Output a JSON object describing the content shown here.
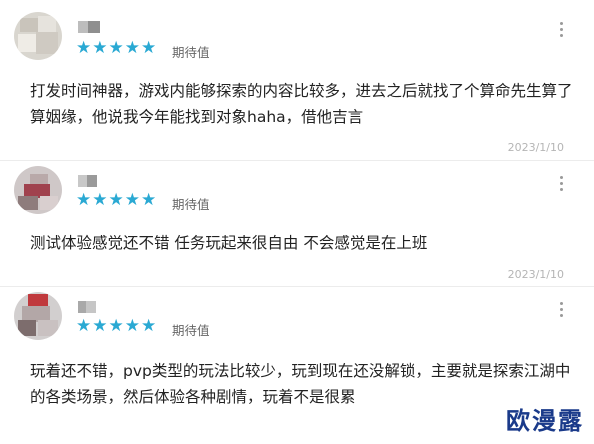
{
  "colors": {
    "star": "#2aa9d3",
    "watermark": "#1a3a8a"
  },
  "reviews": [
    {
      "rating": 5,
      "rating_label": "期待值",
      "text": "打发时间神器，游戏内能够探索的内容比较多，进去之后就找了个算命先生算了算姻缘，他说我今年能找到对象haha，借他吉言",
      "date": "2023/1/10"
    },
    {
      "rating": 5,
      "rating_label": "期待值",
      "text": "测试体验感觉还不错 任务玩起来很自由 不会感觉是在上班",
      "date": "2023/1/10"
    },
    {
      "rating": 5,
      "rating_label": "期待值",
      "text": "玩着还不错，pvp类型的玩法比较少，玩到现在还没解锁，主要就是探索江湖中的各类场景，然后体验各种剧情，玩着不是很累",
      "date": ""
    }
  ],
  "watermark": "欧漫露"
}
